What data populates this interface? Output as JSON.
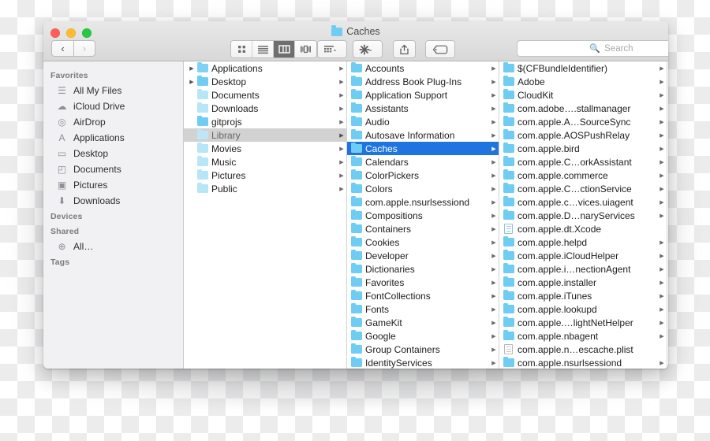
{
  "window": {
    "title": "Caches",
    "title_icon": "folder-icon",
    "traffic_lights": [
      {
        "name": "close-button",
        "color": "#ff5f57"
      },
      {
        "name": "minimize-button",
        "color": "#ffbd2e"
      },
      {
        "name": "maximize-button",
        "color": "#28c840"
      }
    ]
  },
  "toolbar": {
    "back_label": "‹",
    "forward_label": "›",
    "view_buttons": [
      {
        "name": "icon-view-button",
        "glyph": "icon-grid-icon",
        "active": false
      },
      {
        "name": "list-view-button",
        "glyph": "list-lines-icon",
        "active": false
      },
      {
        "name": "column-view-button",
        "glyph": "columns-icon",
        "active": true
      },
      {
        "name": "gallery-view-button",
        "glyph": "coverflow-icon",
        "active": false
      }
    ],
    "arrange_label": "arrange-icon",
    "action_label": "gear-icon",
    "share_label": "share-icon",
    "tag_label": "tag-icon",
    "chevron": "⌄"
  },
  "search": {
    "placeholder": "Search",
    "icon": "search-icon",
    "value": ""
  },
  "sidebar": {
    "sections": [
      {
        "header": "Favorites",
        "items": [
          {
            "label": "All My Files",
            "icon": "all-my-files-icon",
            "glyph": "☰"
          },
          {
            "label": "iCloud Drive",
            "icon": "cloud-icon",
            "glyph": "☁"
          },
          {
            "label": "AirDrop",
            "icon": "airdrop-icon",
            "glyph": "◎"
          },
          {
            "label": "Applications",
            "icon": "applications-icon",
            "glyph": "A"
          },
          {
            "label": "Desktop",
            "icon": "desktop-icon",
            "glyph": "▭"
          },
          {
            "label": "Documents",
            "icon": "documents-icon",
            "glyph": "◰"
          },
          {
            "label": "Pictures",
            "icon": "pictures-icon",
            "glyph": "▣"
          },
          {
            "label": "Downloads",
            "icon": "downloads-icon",
            "glyph": "⬇"
          }
        ]
      },
      {
        "header": "Devices",
        "items": []
      },
      {
        "header": "Shared",
        "items": [
          {
            "label": "All…",
            "icon": "network-globe-icon",
            "glyph": "⊕"
          }
        ]
      },
      {
        "header": "Tags",
        "items": []
      }
    ]
  },
  "columns": [
    {
      "name": "column-home",
      "rows": [
        {
          "label": "Applications",
          "icon": "folder-icon",
          "tint": "tinted",
          "left_disclosure": true,
          "disclosure": true,
          "selected": "none"
        },
        {
          "label": "Desktop",
          "icon": "folder-icon",
          "tint": "plain",
          "left_disclosure": true,
          "disclosure": true,
          "selected": "none"
        },
        {
          "label": "Documents",
          "icon": "folder-icon",
          "tint": "light",
          "left_disclosure": false,
          "disclosure": true,
          "selected": "none"
        },
        {
          "label": "Downloads",
          "icon": "folder-icon",
          "tint": "light",
          "left_disclosure": false,
          "disclosure": true,
          "selected": "none"
        },
        {
          "label": "gitprojs",
          "icon": "folder-icon",
          "tint": "plain",
          "left_disclosure": false,
          "disclosure": true,
          "selected": "none"
        },
        {
          "label": "Library",
          "icon": "folder-icon",
          "tint": "plain",
          "left_disclosure": false,
          "disclosure": true,
          "selected": "grey"
        },
        {
          "label": "Movies",
          "icon": "folder-icon",
          "tint": "light",
          "left_disclosure": false,
          "disclosure": true,
          "selected": "none"
        },
        {
          "label": "Music",
          "icon": "folder-icon",
          "tint": "light",
          "left_disclosure": false,
          "disclosure": true,
          "selected": "none"
        },
        {
          "label": "Pictures",
          "icon": "folder-icon",
          "tint": "light",
          "left_disclosure": false,
          "disclosure": true,
          "selected": "none"
        },
        {
          "label": "Public",
          "icon": "folder-icon",
          "tint": "light",
          "left_disclosure": false,
          "disclosure": true,
          "selected": "none"
        }
      ]
    },
    {
      "name": "column-library",
      "rows": [
        {
          "label": "Accounts",
          "icon": "folder-icon",
          "disclosure": true,
          "selected": "none"
        },
        {
          "label": "Address Book Plug-Ins",
          "icon": "folder-icon",
          "disclosure": true,
          "selected": "none"
        },
        {
          "label": "Application Support",
          "icon": "folder-icon",
          "disclosure": true,
          "selected": "none"
        },
        {
          "label": "Assistants",
          "icon": "folder-icon",
          "disclosure": true,
          "selected": "none"
        },
        {
          "label": "Audio",
          "icon": "folder-icon",
          "disclosure": true,
          "selected": "none"
        },
        {
          "label": "Autosave Information",
          "icon": "folder-icon",
          "disclosure": true,
          "selected": "none"
        },
        {
          "label": "Caches",
          "icon": "folder-icon",
          "disclosure": true,
          "selected": "blue"
        },
        {
          "label": "Calendars",
          "icon": "folder-icon",
          "disclosure": true,
          "selected": "none"
        },
        {
          "label": "ColorPickers",
          "icon": "folder-icon",
          "disclosure": true,
          "selected": "none"
        },
        {
          "label": "Colors",
          "icon": "folder-icon",
          "disclosure": true,
          "selected": "none"
        },
        {
          "label": "com.apple.nsurlsessiond",
          "icon": "folder-icon",
          "disclosure": true,
          "selected": "none"
        },
        {
          "label": "Compositions",
          "icon": "folder-icon",
          "disclosure": true,
          "selected": "none"
        },
        {
          "label": "Containers",
          "icon": "folder-icon",
          "disclosure": true,
          "selected": "none"
        },
        {
          "label": "Cookies",
          "icon": "folder-icon",
          "disclosure": true,
          "selected": "none"
        },
        {
          "label": "Developer",
          "icon": "folder-icon",
          "disclosure": true,
          "selected": "none"
        },
        {
          "label": "Dictionaries",
          "icon": "folder-icon",
          "disclosure": true,
          "selected": "none"
        },
        {
          "label": "Favorites",
          "icon": "folder-icon",
          "disclosure": true,
          "selected": "none"
        },
        {
          "label": "FontCollections",
          "icon": "folder-icon",
          "disclosure": true,
          "selected": "none"
        },
        {
          "label": "Fonts",
          "icon": "folder-icon",
          "disclosure": true,
          "selected": "none"
        },
        {
          "label": "GameKit",
          "icon": "folder-icon",
          "disclosure": true,
          "selected": "none"
        },
        {
          "label": "Google",
          "icon": "folder-icon",
          "disclosure": true,
          "selected": "none"
        },
        {
          "label": "Group Containers",
          "icon": "folder-icon",
          "disclosure": true,
          "selected": "none"
        },
        {
          "label": "IdentityServices",
          "icon": "folder-icon",
          "disclosure": true,
          "selected": "none"
        }
      ]
    },
    {
      "name": "column-caches",
      "rows": [
        {
          "label": "$(CFBundleIdentifier)",
          "icon": "folder-icon",
          "disclosure": true,
          "selected": "none"
        },
        {
          "label": "Adobe",
          "icon": "folder-icon",
          "disclosure": true,
          "selected": "none"
        },
        {
          "label": "CloudKit",
          "icon": "folder-icon",
          "disclosure": true,
          "selected": "none"
        },
        {
          "label": "com.adobe….stallmanager",
          "icon": "folder-icon",
          "disclosure": true,
          "selected": "none"
        },
        {
          "label": "com.apple.A…SourceSync",
          "icon": "folder-icon",
          "disclosure": true,
          "selected": "none"
        },
        {
          "label": "com.apple.AOSPushRelay",
          "icon": "folder-icon",
          "disclosure": true,
          "selected": "none"
        },
        {
          "label": "com.apple.bird",
          "icon": "folder-icon",
          "disclosure": true,
          "selected": "none"
        },
        {
          "label": "com.apple.C…orkAssistant",
          "icon": "folder-icon",
          "disclosure": true,
          "selected": "none"
        },
        {
          "label": "com.apple.commerce",
          "icon": "folder-icon",
          "disclosure": true,
          "selected": "none"
        },
        {
          "label": "com.apple.C…ctionService",
          "icon": "folder-icon",
          "disclosure": true,
          "selected": "none"
        },
        {
          "label": "com.apple.c…vices.uiagent",
          "icon": "folder-icon",
          "disclosure": true,
          "selected": "none"
        },
        {
          "label": "com.apple.D…naryServices",
          "icon": "folder-icon",
          "disclosure": true,
          "selected": "none"
        },
        {
          "label": "com.apple.dt.Xcode",
          "icon": "document-icon",
          "disclosure": false,
          "selected": "none"
        },
        {
          "label": "com.apple.helpd",
          "icon": "folder-icon",
          "disclosure": true,
          "selected": "none"
        },
        {
          "label": "com.apple.iCloudHelper",
          "icon": "folder-icon",
          "disclosure": true,
          "selected": "none"
        },
        {
          "label": "com.apple.i…nectionAgent",
          "icon": "folder-icon",
          "disclosure": true,
          "selected": "none"
        },
        {
          "label": "com.apple.installer",
          "icon": "folder-icon",
          "disclosure": true,
          "selected": "none"
        },
        {
          "label": "com.apple.iTunes",
          "icon": "folder-icon",
          "disclosure": true,
          "selected": "none"
        },
        {
          "label": "com.apple.lookupd",
          "icon": "folder-icon",
          "disclosure": true,
          "selected": "none"
        },
        {
          "label": "com.apple.…lightNetHelper",
          "icon": "folder-icon",
          "disclosure": true,
          "selected": "none"
        },
        {
          "label": "com.apple.nbagent",
          "icon": "folder-icon",
          "disclosure": true,
          "selected": "none"
        },
        {
          "label": "com.apple.n…escache.plist",
          "icon": "document-icon",
          "disclosure": false,
          "selected": "none"
        },
        {
          "label": "com.apple.nsurlsessiond",
          "icon": "folder-icon",
          "disclosure": true,
          "selected": "none"
        }
      ]
    }
  ],
  "colors": {
    "selection_blue": "#1f74e0",
    "folder_blue": "#6fcdf3",
    "sidebar_bg": "#f1f1f3",
    "titlebar_top": "#e9e8e8",
    "titlebar_bottom": "#d9d8d8"
  }
}
